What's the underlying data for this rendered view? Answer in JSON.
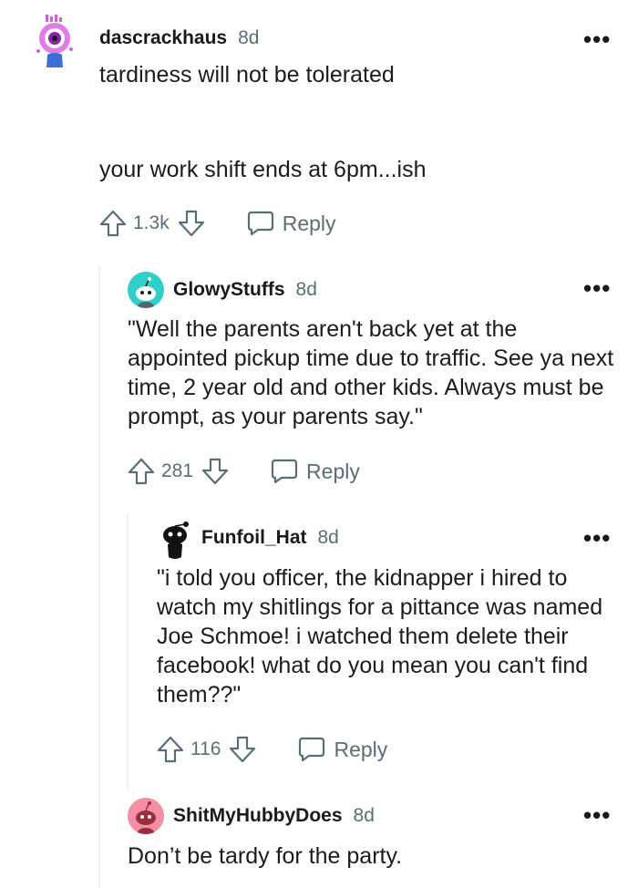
{
  "colors": {
    "meta_grey": "#576f76",
    "text": "#1c1c1c",
    "thread_line": "#edeff1",
    "avatar_teal": "#2fd0c9",
    "avatar_pink": "#f48fa3",
    "avatar_magenta": "#d65bdc"
  },
  "comments": [
    {
      "username": "dascrackhaus",
      "age": "8d",
      "avatar": "purple-eye-avatar",
      "body_lines": [
        "tardiness will not be tolerated",
        "",
        "",
        "your work shift ends at 6pm...ish"
      ],
      "votes": "1.3k",
      "reply_label": "Reply"
    },
    {
      "username": "GlowyStuffs",
      "age": "8d",
      "avatar": "teal-snoo-avatar",
      "body": "\"Well the parents aren't back yet at the appointed pickup time due to traffic. See ya next time, 2 year old and other kids. Always must be prompt, as your parents say.\"",
      "votes": "281",
      "reply_label": "Reply"
    },
    {
      "username": "Funfoil_Hat",
      "age": "8d",
      "avatar": "black-snoo-avatar",
      "body": "\"i told you officer, the kidnapper i hired to watch my shitlings for a pittance was named Joe Schmoe! i watched them delete their facebook! what do you mean you can't find them??\"",
      "votes": "116",
      "reply_label": "Reply"
    },
    {
      "username": "ShitMyHubbyDoes",
      "age": "8d",
      "avatar": "pink-snoo-avatar",
      "body": "Don’t be tardy for the party."
    }
  ],
  "more_icon": "ellipsis-icon"
}
